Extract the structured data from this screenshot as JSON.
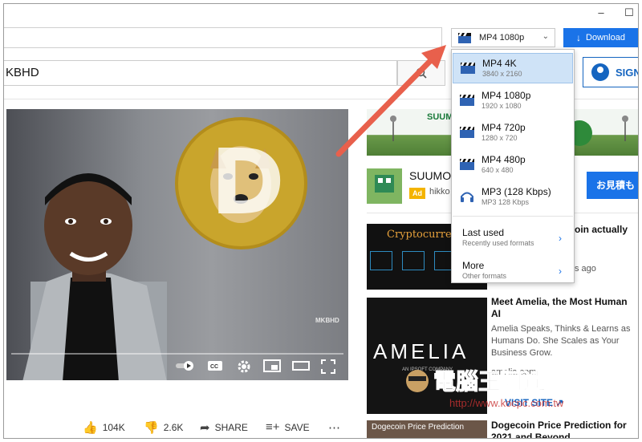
{
  "window": {
    "minimize_glyph": "–",
    "maximize_glyph": "☐"
  },
  "toolbar": {
    "format_selected": "MP4 1080p",
    "download_label": "Download"
  },
  "youtube": {
    "search_value": "KBHD",
    "signin_label": "SIGN",
    "video_watermark": "MKBHD",
    "likes": "104K",
    "dislikes": "2.6K",
    "share": "SHARE",
    "save": "SAVE"
  },
  "sidebar": {
    "banner_brand": "SUUMO",
    "ad_title": "SUUMO",
    "ad_badge": "Ad",
    "ad_source": "hikko",
    "ad_button": "お見積も",
    "video1_thumb_text": "Cryptocurrency",
    "video1_title_l1": "oin actually",
    "video1_meta": "s ago",
    "video2_thumb_text": "AMELIA",
    "video2_thumb_sub": "AN IPSOFT COMPANY",
    "video2_title_l1": "Meet Amelia, the Most Human",
    "video2_title_l2": "AI",
    "video2_desc_l1": "Amelia Speaks, Thinks & Learns as",
    "video2_desc_l2": "Humans Do. She Scales as Your",
    "video2_desc_l3": "Business Grow.",
    "video2_desc_l4": "amelia.com",
    "visit_site": "VISIT SITE",
    "video3_thumb_text": "Dogecoin Price Prediction",
    "video3_title_l1": "Dogecoin Price Prediction for",
    "video3_title_l2": "2021 and Beyond"
  },
  "dropdown": {
    "items": [
      {
        "title": "MP4 4K",
        "sub": "3840 x 2160",
        "icon": "video-clapper-icon",
        "selected": true
      },
      {
        "title": "MP4 1080p",
        "sub": "1920 x 1080",
        "icon": "video-clapper-icon",
        "selected": false
      },
      {
        "title": "MP4 720p",
        "sub": "1280 x 720",
        "icon": "video-clapper-icon",
        "selected": false
      },
      {
        "title": "MP4 480p",
        "sub": "640 x 480",
        "icon": "video-clapper-icon",
        "selected": false
      },
      {
        "title": "MP3 (128 Kbps)",
        "sub": "MP3 128 Kbps",
        "icon": "headphones-icon",
        "selected": false
      }
    ],
    "last_used": {
      "title": "Last used",
      "sub": "Recently used formats"
    },
    "more": {
      "title": "More",
      "sub": "Other formats"
    }
  },
  "watermark": {
    "line1": "電腦王阿達",
    "line2": "http://www.kocpc.com.tw"
  },
  "colors": {
    "accent": "#1a73e8",
    "arrow": "#e8604c",
    "selected_bg": "#cfe3f7"
  }
}
